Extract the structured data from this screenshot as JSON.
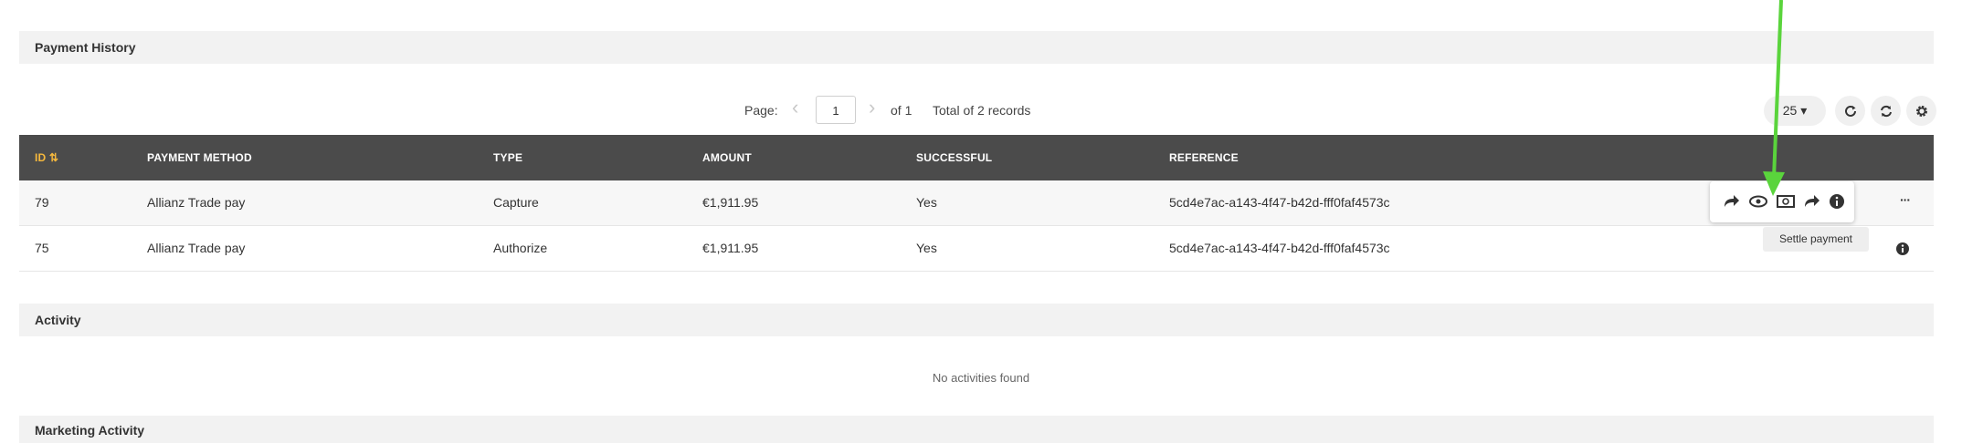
{
  "sections": {
    "payment_history": "Payment History",
    "activity": "Activity",
    "marketing_activity": "Marketing Activity"
  },
  "pager": {
    "page_label": "Page:",
    "current_page": "1",
    "of_label": "of 1",
    "total_label": "Total of 2 records",
    "prev_glyph": "‹",
    "next_glyph": "›",
    "page_size": "25 ▾"
  },
  "table": {
    "columns": [
      "ID ⇅",
      "PAYMENT METHOD",
      "TYPE",
      "AMOUNT",
      "SUCCESSFUL",
      "REFERENCE"
    ],
    "rows": [
      {
        "id": "79",
        "method": "Allianz Trade pay",
        "type": "Capture",
        "amount": "€1,911.95",
        "successful": "Yes",
        "reference": "5cd4e7ac-a143-4f47-b42d-fff0faf4573c"
      },
      {
        "id": "75",
        "method": "Allianz Trade pay",
        "type": "Authorize",
        "amount": "€1,911.95",
        "successful": "Yes",
        "reference": "5cd4e7ac-a143-4f47-b42d-fff0faf4573c"
      }
    ],
    "more_glyph": "···"
  },
  "tooltip": "Settle payment",
  "activity": {
    "empty_text": "No activities found"
  },
  "colors": {
    "header_bg": "#4b4b4b",
    "sort_accent": "#f5b83d",
    "annotation_arrow": "#5ad43c"
  },
  "icons": [
    "forward-icon",
    "settle-payment-icon",
    "cash-icon",
    "forward-icon",
    "info-icon",
    "refresh-icon",
    "sync-icon",
    "gear-icon",
    "more-icon"
  ]
}
